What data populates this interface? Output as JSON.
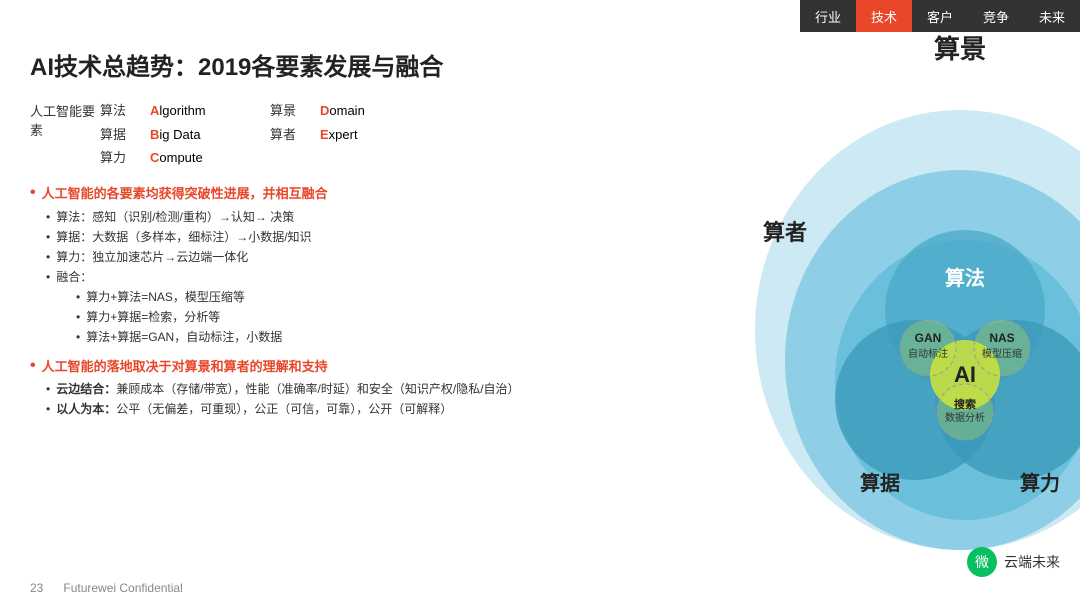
{
  "nav": {
    "items": [
      {
        "label": "行业",
        "active": false
      },
      {
        "label": "技术",
        "active": true
      },
      {
        "label": "客户",
        "active": false
      },
      {
        "label": "竞争",
        "active": false
      },
      {
        "label": "未来",
        "active": false
      }
    ]
  },
  "title": "AI技术总趋势：2019各要素发展与融合",
  "elements": {
    "label": "人工智能要素",
    "rows": [
      {
        "cn": "算法",
        "en_prefix": "A",
        "en_rest": "lgorithm",
        "cn2": "算景",
        "en2_prefix": "D",
        "en2_rest": "omain"
      },
      {
        "cn": "算据",
        "en_prefix": "B",
        "en_rest": "ig Data",
        "cn2": "算者",
        "en2_prefix": "E",
        "en2_rest": "xpert"
      },
      {
        "cn": "算力",
        "en_prefix": "C",
        "en_rest": "ompute",
        "cn2": "",
        "en2_prefix": "",
        "en2_rest": ""
      }
    ]
  },
  "bullets": [
    {
      "main": "人工智能的各要素均获得突破性进展，并相互融合",
      "subs": [
        "算法：感知（识别/检测/重构）→认知→ 决策",
        "算据：大数据（多样本，细标注）→小数据/知识",
        "算力：独立加速芯片→云边端一体化",
        "融合："
      ],
      "subsubs": [
        "算力+算法=NAS，模型压缩等",
        "算力+算据=检索，分析等",
        "算法+算据=GAN，自动标注，小数据"
      ]
    },
    {
      "main": "人工智能的落地取决于对算景和算者的理解和支持",
      "subs": [
        "云边结合：兼顾成本（存储/带宽），性能（准确率/时延）和安全（知识产权/隐私/自治）",
        "以人为本：公平（无偏差，可重现），公正（可信，可靠），公开（可解释）"
      ],
      "subsubs": []
    }
  ],
  "footer": {
    "page": "23",
    "confidential": "Futurewei Confidential"
  },
  "diagram": {
    "title_top": "算景",
    "title_left": "算者",
    "title_bottom_left": "算据",
    "title_bottom_right": "算力",
    "center_label": "算法",
    "ai_label": "AI",
    "circles": [
      {
        "label": "GAN",
        "sublabel": "自动标注"
      },
      {
        "label": "NAS",
        "sublabel": "模型压缩"
      },
      {
        "label": "搜索",
        "sublabel": "数据分析"
      }
    ]
  },
  "wechat": {
    "text": "云端未来"
  }
}
